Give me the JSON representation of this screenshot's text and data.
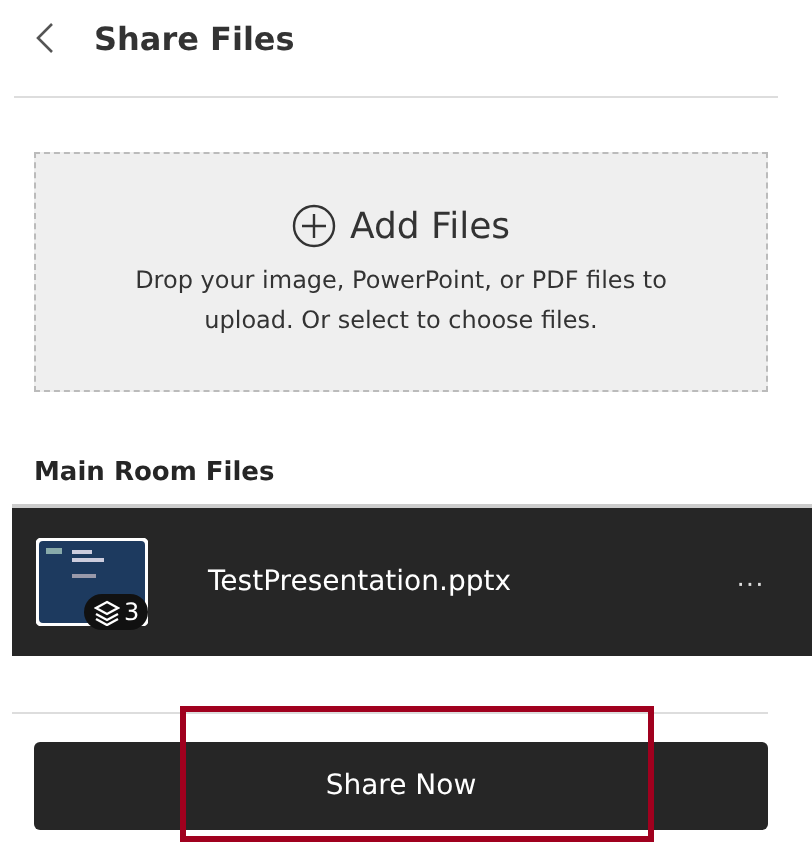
{
  "header": {
    "title": "Share Files"
  },
  "drop_zone": {
    "title": "Add Files",
    "hint": "Drop your image, PowerPoint, or PDF files to upload. Or select to choose files."
  },
  "section": {
    "title": "Main Room Files"
  },
  "files": [
    {
      "name": "TestPresentation.pptx",
      "slide_count": "3",
      "more": "···"
    }
  ],
  "share_button": {
    "label": "Share Now",
    "highlighted": true
  }
}
